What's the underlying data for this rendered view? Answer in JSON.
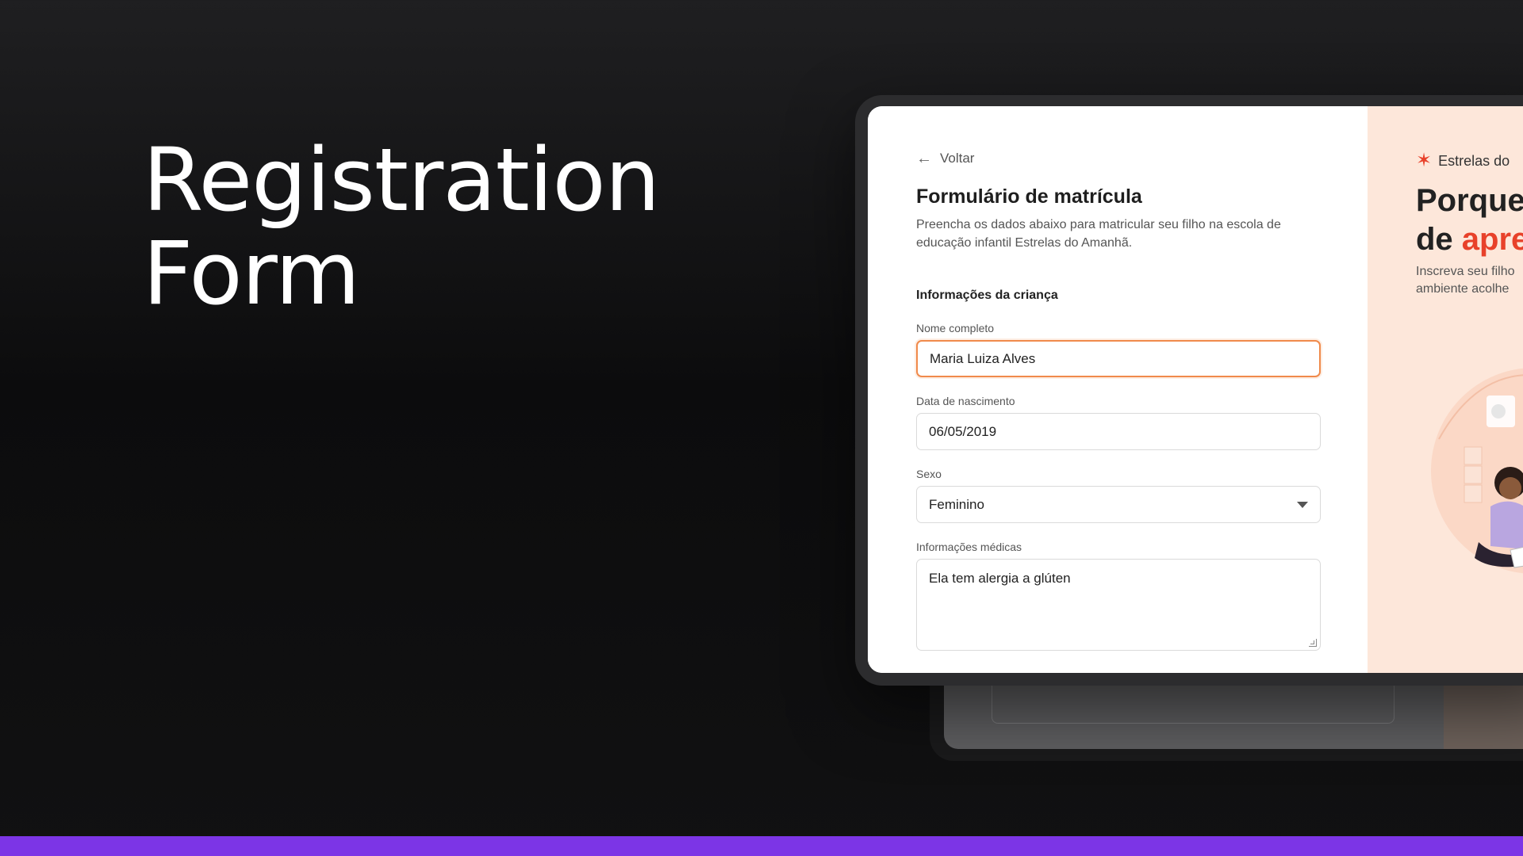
{
  "hero": {
    "title_line1": "Registration",
    "title_line2": "Form"
  },
  "form": {
    "back_label": "Voltar",
    "title": "Formulário de matrícula",
    "description": "Preencha os dados abaixo para matricular seu filho na escola de educação infantil Estrelas do Amanhã.",
    "section_title": "Informações da criança",
    "fields": {
      "full_name": {
        "label": "Nome completo",
        "value": "Maria Luiza Alves"
      },
      "birth_date": {
        "label": "Data de nascimento",
        "value": "06/05/2019"
      },
      "sex": {
        "label": "Sexo",
        "value": "Feminino"
      },
      "medical": {
        "label": "Informações médicas",
        "value": "Ela tem alergia a glúten"
      }
    }
  },
  "promo": {
    "brand": "Estrelas do",
    "heading_line1": "Porque",
    "heading_line2_prefix": "de ",
    "heading_line2_accent": "apre",
    "sub_line1": "Inscreva seu filho",
    "sub_line2": "ambiente acolhe"
  },
  "colors": {
    "accent_orange": "#f08a4b",
    "brand_red": "#e8412a",
    "promo_bg": "#fde7da",
    "bottom_bar": "#7c35e6"
  }
}
